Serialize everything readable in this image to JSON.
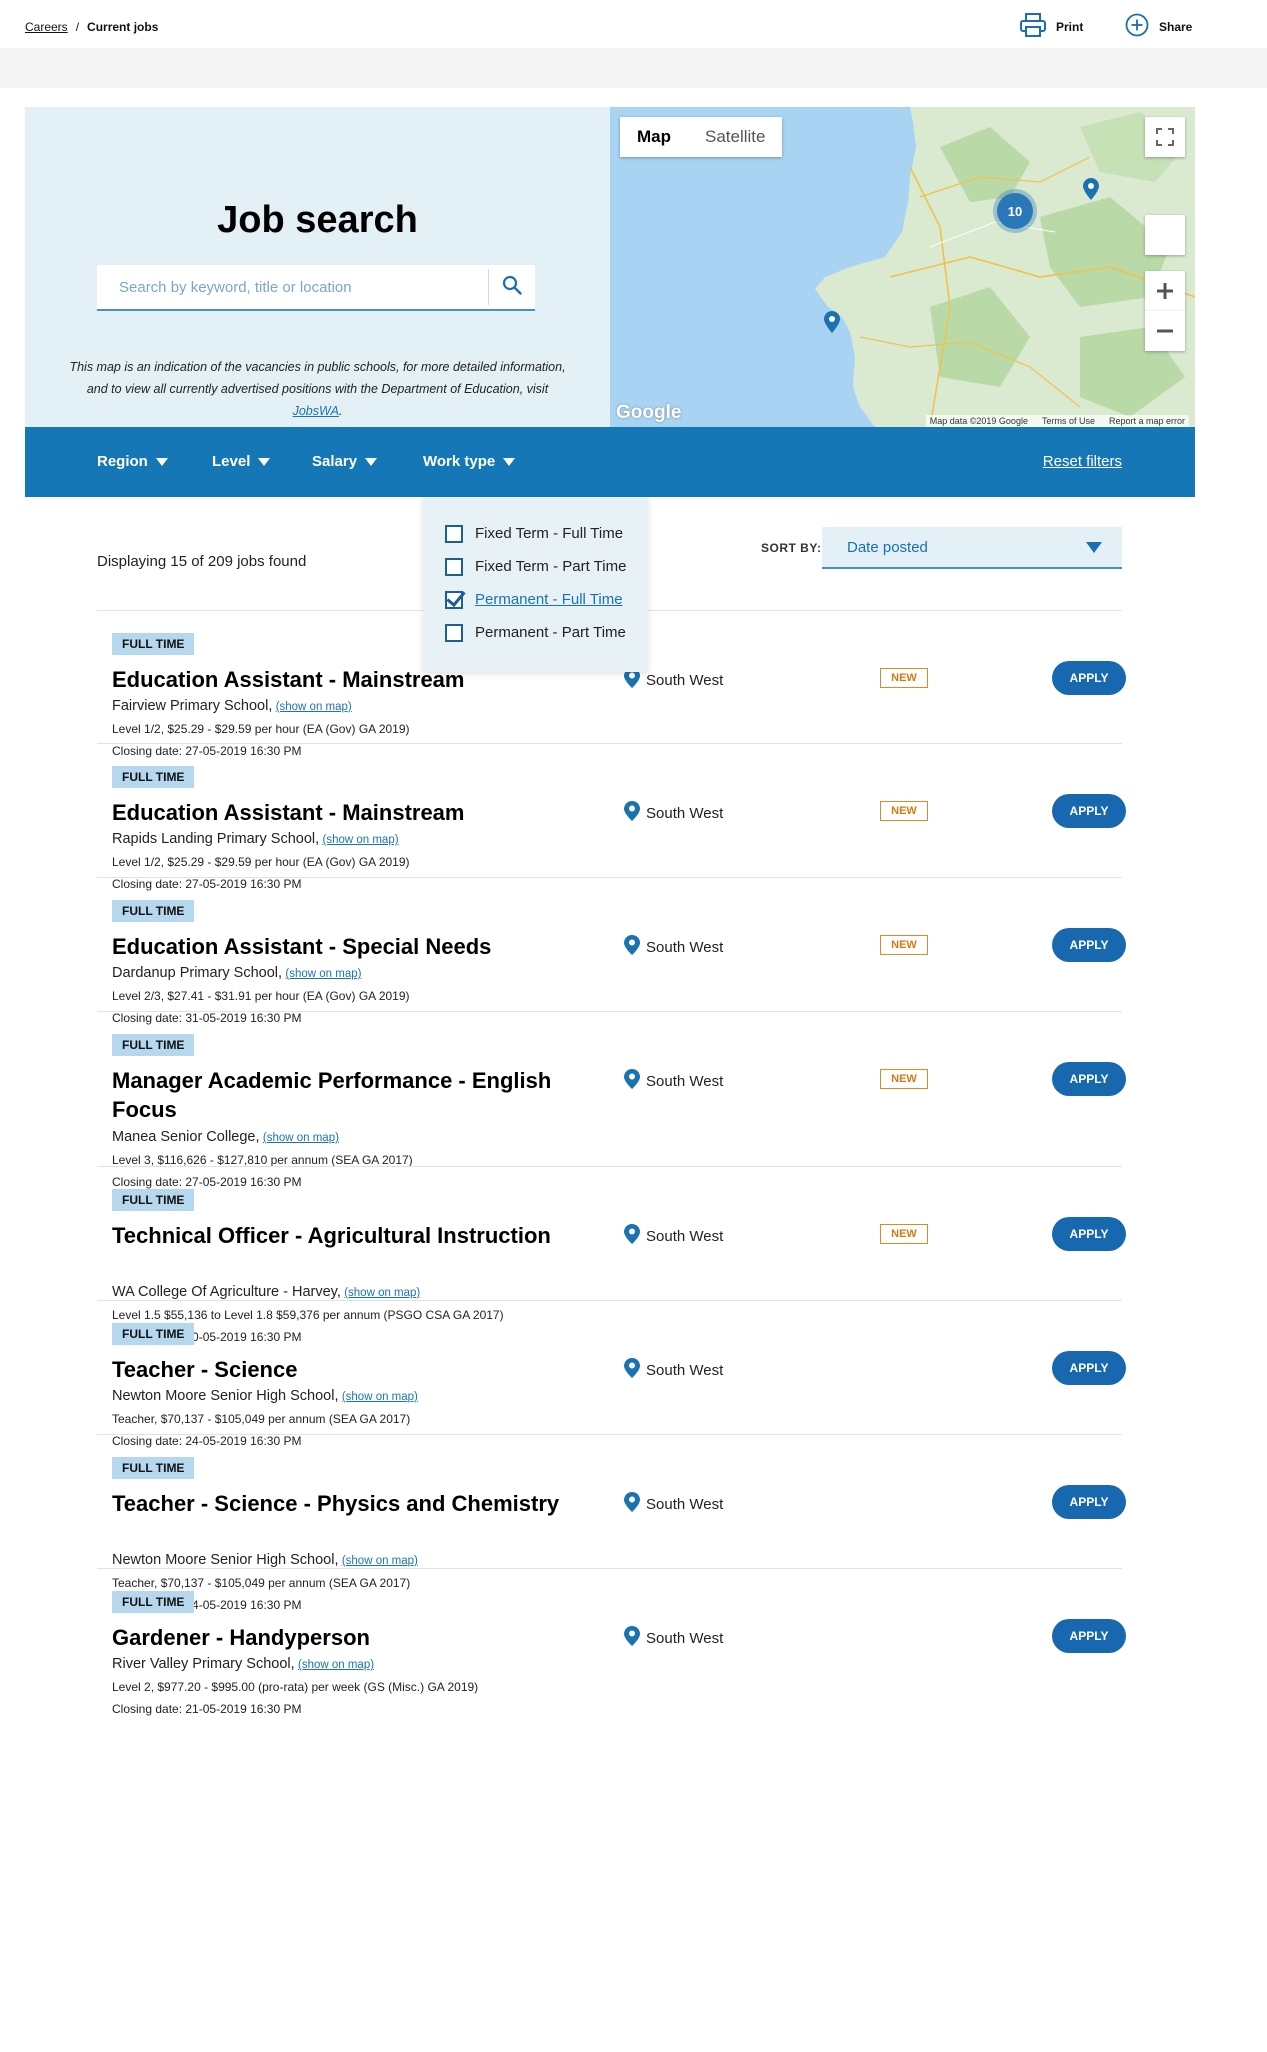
{
  "breadcrumb": {
    "parent": "Careers",
    "separator": "/",
    "current": "Current jobs"
  },
  "toolbar": {
    "print_label": "Print",
    "share_label": "Share"
  },
  "hero": {
    "title": "Job search",
    "search_placeholder": "Search by keyword, title or location",
    "note_text": "This map is an indication of the vacancies in public schools, for more detailed information, and to view all currently advertised positions with the Department of Education, visit ",
    "note_link": "JobsWA",
    "note_end": "."
  },
  "map": {
    "tab_map": "Map",
    "tab_satellite": "Satellite",
    "cluster_count": "10",
    "google_logo": "Google",
    "data_credit": "Map data ©2019 Google",
    "terms": "Terms of Use",
    "report": "Report a map error"
  },
  "filters": {
    "region": "Region",
    "level": "Level",
    "salary": "Salary",
    "work_type": "Work type",
    "reset": "Reset filters"
  },
  "work_type_options": [
    {
      "label": "Fixed Term - Full Time",
      "checked": false
    },
    {
      "label": "Fixed Term - Part Time",
      "checked": false
    },
    {
      "label": "Permanent - Full Time",
      "checked": true
    },
    {
      "label": "Permanent - Part Time",
      "checked": false
    }
  ],
  "results": {
    "count_text": "Displaying 15 of 209 jobs found",
    "sort_label": "SORT BY:",
    "sort_value": "Date posted"
  },
  "labels": {
    "show_on_map": "(show on map)",
    "new_badge": "NEW",
    "apply": "APPLY"
  },
  "colors": {
    "brand_blue": "#1677b6",
    "badge_blue": "#b6d8ee",
    "new_orange": "#e0892b",
    "link_blue": "#1a73b5"
  },
  "jobs": [
    {
      "type": "FULL TIME",
      "title": "Education Assistant - Mainstream",
      "school": "Fairview Primary School,",
      "pay": "Level 1/2, $25.29 - $29.59 per hour (EA (Gov) GA 2019)",
      "closing": "Closing date: 27-05-2019 16:30 PM",
      "location": "South West",
      "new": true
    },
    {
      "type": "FULL TIME",
      "title": "Education Assistant - Mainstream",
      "school": "Rapids Landing Primary School,",
      "pay": "Level 1/2, $25.29 - $29.59 per hour (EA (Gov) GA 2019)",
      "closing": "Closing date: 27-05-2019 16:30 PM",
      "location": "South West",
      "new": true
    },
    {
      "type": "FULL TIME",
      "title": "Education Assistant - Special Needs",
      "school": "Dardanup Primary School,",
      "pay": "Level 2/3, $27.41 - $31.91 per hour (EA (Gov) GA 2019)",
      "closing": "Closing date: 31-05-2019 16:30 PM",
      "location": "South West",
      "new": true
    },
    {
      "type": "FULL TIME",
      "title": "Manager Academic Performance - English Focus",
      "school": "Manea Senior College,",
      "pay": "Level 3, $116,626 - $127,810 per annum (SEA GA 2017)",
      "closing": "Closing date: 27-05-2019 16:30 PM",
      "location": "South West",
      "new": true
    },
    {
      "type": "FULL TIME",
      "title": "Technical Officer - Agricultural Instruction",
      "school": "WA College Of Agriculture - Harvey,",
      "pay": "Level 1.5 $55,136 to Level 1.8 $59,376 per annum (PSGO CSA GA 2017)",
      "closing": "Closing date: 30-05-2019 16:30 PM",
      "location": "South West",
      "new": true
    },
    {
      "type": "FULL TIME",
      "title": "Teacher - Science",
      "school": "Newton Moore Senior High School,",
      "pay": "Teacher, $70,137 - $105,049 per annum (SEA GA 2017)",
      "closing": "Closing date: 24-05-2019 16:30 PM",
      "location": "South West",
      "new": false
    },
    {
      "type": "FULL TIME",
      "title": "Teacher - Science - Physics and Chemistry",
      "school": "Newton Moore Senior High School,",
      "pay": "Teacher, $70,137 - $105,049 per annum (SEA GA 2017)",
      "closing": "Closing date: 24-05-2019 16:30 PM",
      "location": "South West",
      "new": false
    },
    {
      "type": "FULL TIME",
      "title": "Gardener - Handyperson",
      "school": "River Valley Primary School,",
      "pay": "Level 2, $977.20 - $995.00 (pro-rata) per week (GS (Misc.) GA 2019)",
      "closing": "Closing date: 21-05-2019 16:30 PM",
      "location": "South West",
      "new": false
    }
  ]
}
